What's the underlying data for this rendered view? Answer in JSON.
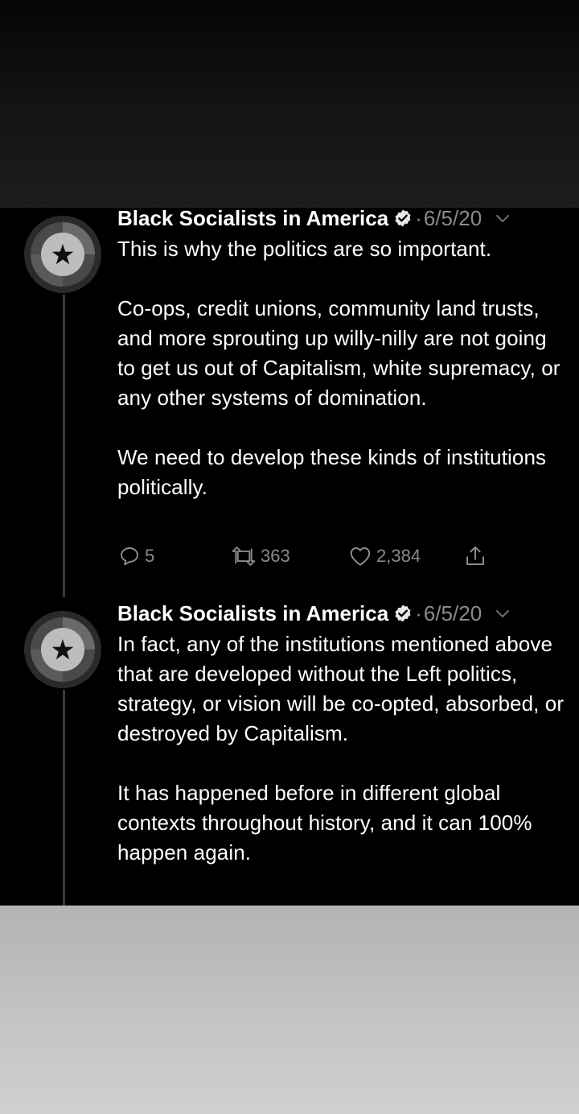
{
  "tweets": [
    {
      "author": "Black Socialists in America",
      "separator": "·",
      "date": "6/5/20",
      "paragraphs": [
        "This is why the politics are so important.",
        "Co-ops, credit unions, community land trusts, and more sprouting up willy-nilly are not going to get us out of Capitalism, white supremacy, or any other systems of domination.",
        "We need to develop these kinds of institutions politically."
      ],
      "replies": "5",
      "retweets": "363",
      "likes": "2,384"
    },
    {
      "author": "Black Socialists in America",
      "separator": "·",
      "date": "6/5/20",
      "paragraphs": [
        "In fact, any of the institutions mentioned above that are developed without the Left politics, strategy, or vision will be co-opted, absorbed, or destroyed by Capitalism.",
        "It has happened before in different global contexts throughout history, and it can 100% happen again."
      ]
    }
  ],
  "icons": {
    "avatar": "star-in-circle-icon",
    "verified": "verified-badge-icon",
    "more": "chevron-down-icon",
    "reply": "reply-icon",
    "retweet": "retweet-icon",
    "like": "heart-icon",
    "share": "share-icon"
  },
  "colors": {
    "background": "#000000",
    "text": "#ffffff",
    "muted": "#8a8a8a",
    "thread_line": "#3a3a3a"
  }
}
